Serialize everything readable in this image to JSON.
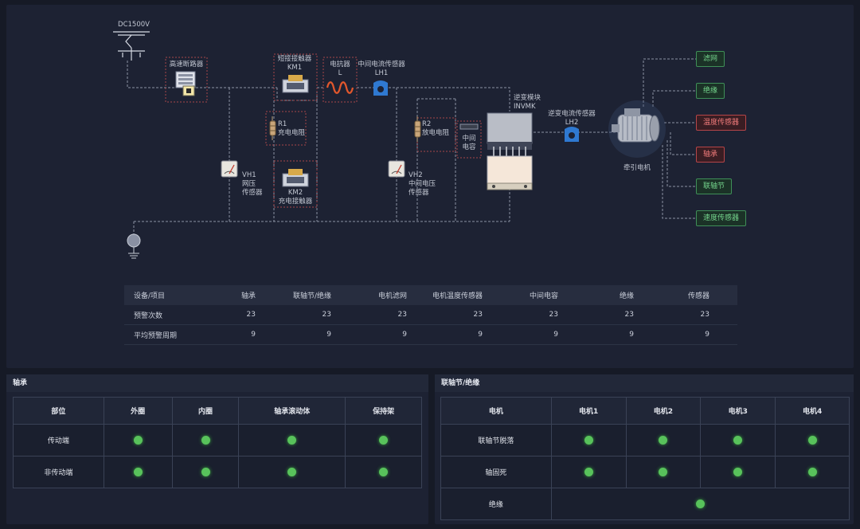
{
  "diagram": {
    "labels": {
      "dc": "DC1500V",
      "breaker": "高速断路器",
      "km1_a": "短接接触器",
      "km1_b": "KM1",
      "reactor_a": "电抗器",
      "reactor_b": "L",
      "lh1_a": "中间电流传感器",
      "lh1_b": "LH1",
      "r1_a": "R1",
      "r1_b": "充电电阻",
      "km2_a": "KM2",
      "km2_b": "充电接触器",
      "vh1_a": "VH1",
      "vh1_b": "网压",
      "vh1_c": "传感器",
      "r2_a": "R2",
      "r2_b": "放电电阻",
      "cap_a": "中间",
      "cap_b": "电容",
      "vh2_a": "VH2",
      "vh2_b": "中间电压",
      "vh2_c": "传感器",
      "inv_a": "逆变模块",
      "inv_b": "INVMK",
      "lh2_a": "逆变电流传感器",
      "lh2_b": "LH2",
      "motor": "牵引电机"
    },
    "tags": [
      {
        "label": "滤网",
        "status": "ok"
      },
      {
        "label": "绝缘",
        "status": "ok"
      },
      {
        "label": "温度传感器",
        "status": "alarm"
      },
      {
        "label": "轴承",
        "status": "alarm"
      },
      {
        "label": "联轴节",
        "status": "ok"
      },
      {
        "label": "速度传感器",
        "status": "ok"
      }
    ],
    "colors": {
      "ok": "#74d48c",
      "alarm": "#f07a7a",
      "line": "#8a91a3",
      "box": "#a8454a"
    }
  },
  "stats": {
    "headers": [
      "设备/项目",
      "轴承",
      "联轴节/绝缘",
      "电机滤网",
      "电机温度传感器",
      "中间电容",
      "绝缘",
      "传感器"
    ],
    "rows": [
      [
        "预警次数",
        "23",
        "23",
        "23",
        "23",
        "23",
        "23",
        "23"
      ],
      [
        "平均预警周期",
        "9",
        "9",
        "9",
        "9",
        "9",
        "9",
        "9"
      ]
    ]
  },
  "bearing": {
    "title": "轴承",
    "headers": [
      "部位",
      "外圈",
      "内圈",
      "轴承滚动体",
      "保持架"
    ],
    "rows": [
      {
        "label": "传动端",
        "status": [
          "ok",
          "ok",
          "ok",
          "ok"
        ]
      },
      {
        "label": "非传动端",
        "status": [
          "ok",
          "ok",
          "ok",
          "ok"
        ]
      }
    ]
  },
  "coupling": {
    "title": "联轴节/绝缘",
    "headers": [
      "电机",
      "电机1",
      "电机2",
      "电机3",
      "电机4"
    ],
    "rows": [
      {
        "label": "联轴节脱落",
        "status": [
          "ok",
          "ok",
          "ok",
          "ok"
        ]
      },
      {
        "label": "轴固死",
        "status": [
          "ok",
          "ok",
          "ok",
          "ok"
        ]
      },
      {
        "label": "绝缘",
        "status": [
          "ok"
        ]
      }
    ]
  }
}
